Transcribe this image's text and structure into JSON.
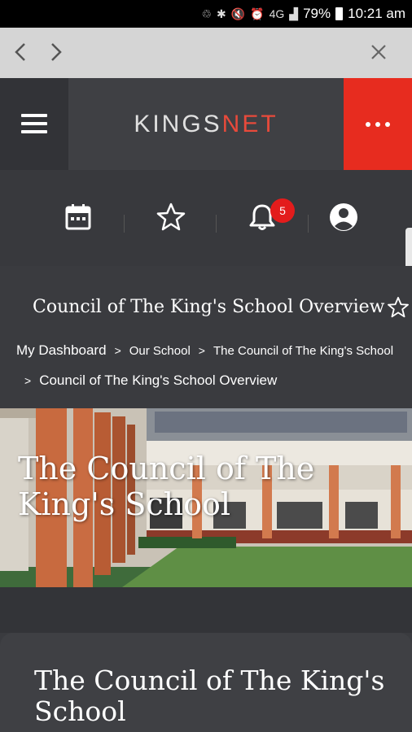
{
  "status_bar": {
    "battery": "79%",
    "time": "10:21 am",
    "network": "4G"
  },
  "browser": {
    "back_icon": "chevron-left-icon",
    "forward_icon": "chevron-right-icon",
    "close_icon": "close-icon"
  },
  "header": {
    "logo_part1": "KINGS",
    "logo_part2": "NET",
    "accent_color": "#e72c1f"
  },
  "toolbar": {
    "notifications_count": "5"
  },
  "page": {
    "title": "Council of The King's School Overview"
  },
  "breadcrumb": {
    "items": [
      "My Dashboard",
      "Our School",
      "The Council of The King's School",
      "Council of The King's School Overview"
    ]
  },
  "hero": {
    "title": "The Council of The King's School"
  },
  "card": {
    "title": "The Council of The King's School"
  }
}
